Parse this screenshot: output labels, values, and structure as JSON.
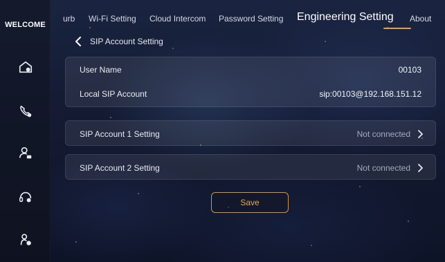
{
  "sidebar": {
    "title": "WELCOME",
    "items": [
      {
        "icon": "home-icon"
      },
      {
        "icon": "phone-icon"
      },
      {
        "icon": "user-lock-icon"
      },
      {
        "icon": "intercom-icon"
      },
      {
        "icon": "settings-user-icon"
      }
    ]
  },
  "tabs": [
    {
      "label": "urb"
    },
    {
      "label": "Wi-Fi Setting"
    },
    {
      "label": "Cloud Intercom"
    },
    {
      "label": "Password Setting"
    },
    {
      "label": "Engineering Setting",
      "active": true
    },
    {
      "label": "About"
    }
  ],
  "page": {
    "back_label": "SIP Account Setting"
  },
  "info": {
    "user_name_label": "User Name",
    "user_name_value": "00103",
    "local_sip_label": "Local SIP Account",
    "local_sip_value": "sip:00103@192.168.151.12"
  },
  "sip_accounts": [
    {
      "label": "SIP Account 1 Setting",
      "status": "Not connected"
    },
    {
      "label": "SIP Account 2 Setting",
      "status": "Not connected"
    }
  ],
  "actions": {
    "save_label": "Save"
  },
  "colors": {
    "accent": "#e7a23b",
    "status_text": "#a3aabb"
  }
}
